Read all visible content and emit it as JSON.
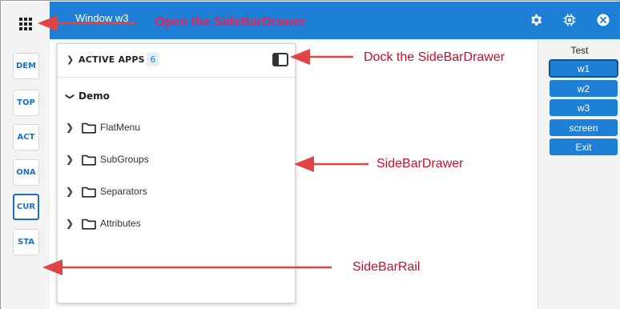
{
  "window": {
    "title": "Window w3"
  },
  "rail": {
    "items": [
      {
        "label": "DEM"
      },
      {
        "label": "TOP"
      },
      {
        "label": "ACT"
      },
      {
        "label": "ONA"
      },
      {
        "label": "CUR",
        "active": true
      },
      {
        "label": "STA"
      }
    ]
  },
  "header": {
    "icons": [
      "gear-icon",
      "chip-icon",
      "close-circle-icon"
    ]
  },
  "drawer": {
    "section_label": "ACTIVE APPS",
    "count": "6",
    "group": "Demo",
    "items": [
      {
        "label": "FlatMenu"
      },
      {
        "label": "SubGroups"
      },
      {
        "label": "Separators"
      },
      {
        "label": "Attributes"
      }
    ]
  },
  "right_panel": {
    "title": "Test",
    "buttons": [
      {
        "label": "w1",
        "selected": true
      },
      {
        "label": "w2"
      },
      {
        "label": "w3"
      },
      {
        "label": "screen"
      },
      {
        "label": "Exit"
      }
    ]
  },
  "annotations": {
    "open_drawer": "Open the SideBarDrawer",
    "dock_drawer": "Dock the SideBarDrawer",
    "drawer": "SideBarDrawer",
    "rail": "SideBarRail"
  },
  "colors": {
    "accent": "#1d7fd6",
    "annotation_text_main": "#e0245e",
    "annotation_text_dark": "#c8102e",
    "arrow": "#e04444"
  }
}
